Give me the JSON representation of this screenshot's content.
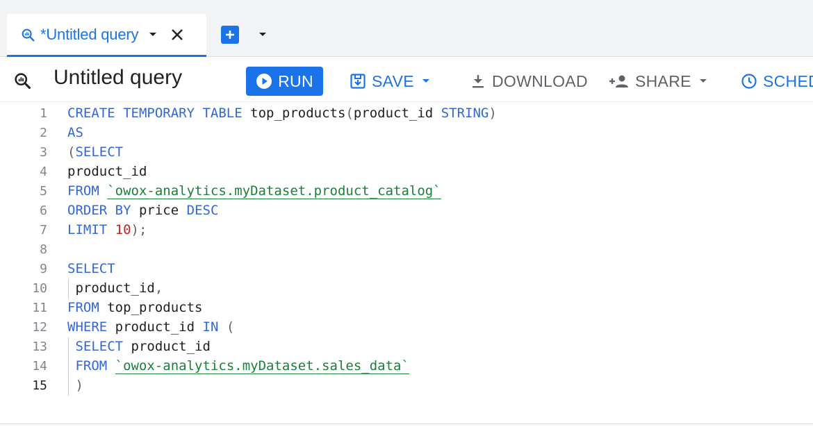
{
  "tab": {
    "label": "*Untitled query"
  },
  "toolbar": {
    "title": "Untitled query",
    "run_label": "RUN",
    "save_label": "SAVE",
    "download_label": "DOWNLOAD",
    "share_label": "SHARE",
    "schedule_label": "SCHED"
  },
  "colors": {
    "accent": "#1a73e8",
    "keyword": "#3367d6",
    "string": "#188038",
    "number": "#c5221f"
  },
  "editor": {
    "active_line": 15,
    "lines": [
      {
        "n": "1"
      },
      {
        "n": "2"
      },
      {
        "n": "3"
      },
      {
        "n": "4"
      },
      {
        "n": "5"
      },
      {
        "n": "6"
      },
      {
        "n": "7"
      },
      {
        "n": "8"
      },
      {
        "n": "9"
      },
      {
        "n": "10"
      },
      {
        "n": "11"
      },
      {
        "n": "12"
      },
      {
        "n": "13"
      },
      {
        "n": "14"
      },
      {
        "n": "15"
      }
    ],
    "tokens": {
      "l1_kw": "CREATE TEMPORARY TABLE",
      "l1_id": "top_products",
      "l1_p1": "(",
      "l1_id2": "product_id",
      "l1_kw2": "STRING",
      "l1_p2": ")",
      "l2_kw": "AS",
      "l3_p": "(",
      "l3_kw": "SELECT",
      "l4_id": "product_id",
      "l5_kw": "FROM",
      "l5_str": "`owox-analytics.myDataset.product_catalog`",
      "l6_kw": "ORDER BY",
      "l6_id": "price",
      "l6_kw2": "DESC",
      "l7_kw": "LIMIT",
      "l7_num": "10",
      "l7_p": ");",
      "l9_kw": "SELECT",
      "l10_id": "product_id",
      "l10_p": ",",
      "l11_kw": "FROM",
      "l11_id": "top_products",
      "l12_kw": "WHERE",
      "l12_id": "product_id",
      "l12_kw2": "IN",
      "l12_p": "(",
      "l13_kw": "SELECT",
      "l13_id": "product_id",
      "l14_kw": "FROM",
      "l14_str": "`owox-analytics.myDataset.sales_data`",
      "l15_p": ")"
    }
  }
}
